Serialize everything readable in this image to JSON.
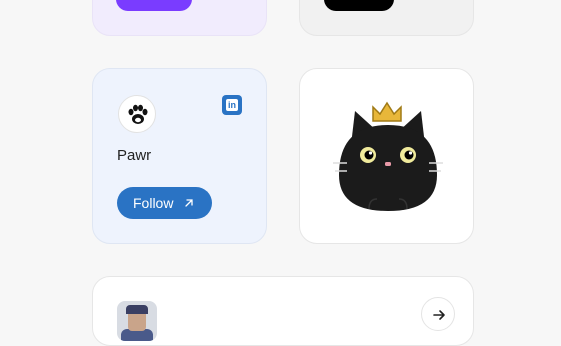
{
  "cards": {
    "pawr": {
      "name": "Pawr",
      "follow_label": "Follow",
      "social_badge": "in",
      "colors": {
        "background": "#eef3fd",
        "button": "#2a73c4"
      }
    }
  },
  "icons": {
    "pawr_logo": "paw-icon",
    "social": "linkedin-icon",
    "follow_arrow": "arrow-up-right-icon",
    "cat_art": "crowned-black-cat",
    "bottom_arrow": "arrow-right-icon"
  },
  "colors": {
    "page_background": "#f7f7f7",
    "top_left_card": "#f1ecfd",
    "top_left_pill": "#7a3cff",
    "top_right_pill": "#000000"
  }
}
